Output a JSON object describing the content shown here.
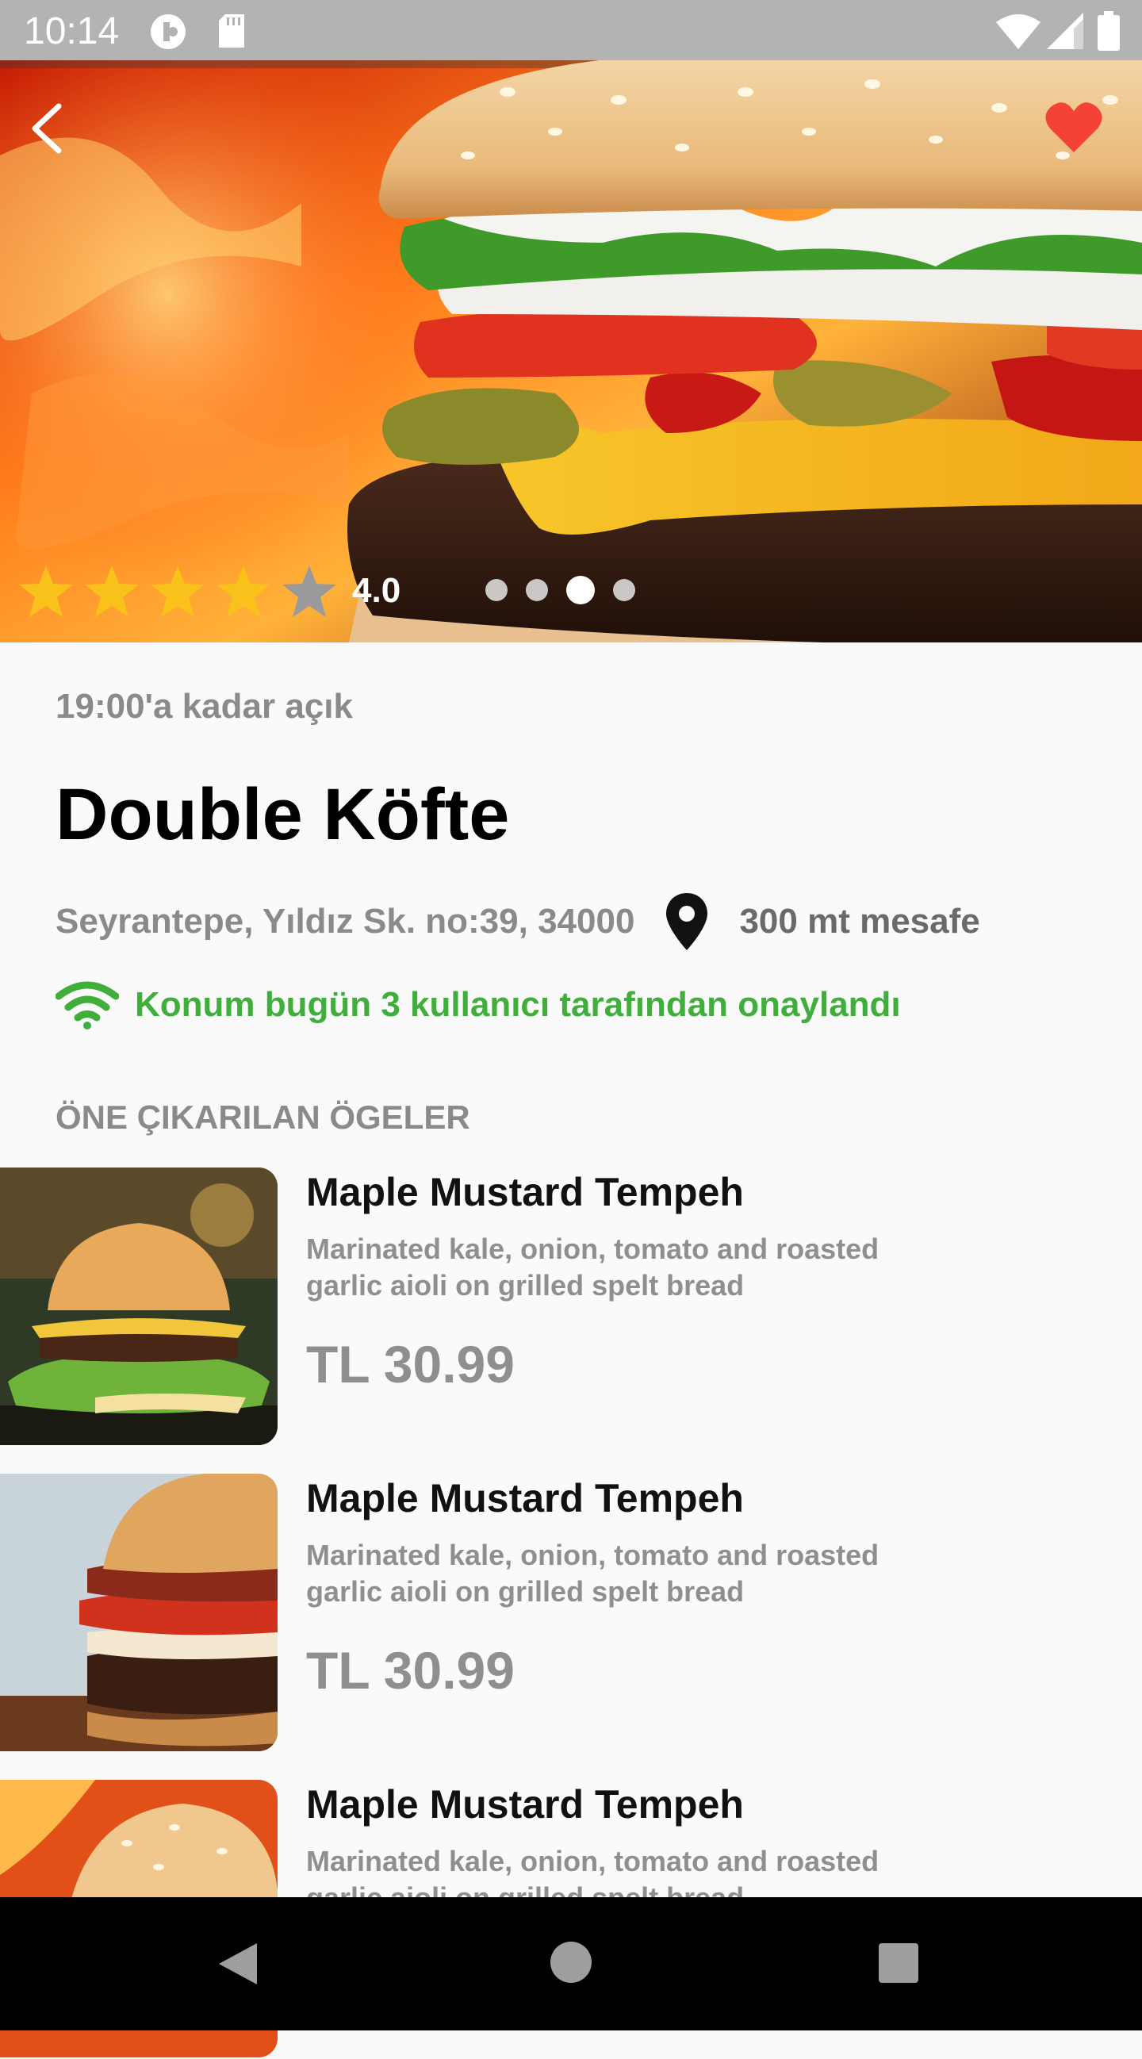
{
  "status_bar": {
    "time": "10:14",
    "icons": [
      "data-saver-icon",
      "sd-card-icon",
      "wifi-icon",
      "cellular-signal-icon",
      "battery-icon"
    ]
  },
  "hero": {
    "rating": "4.0",
    "rating_stars": 4,
    "rating_max": 5,
    "slides_count": 4,
    "active_slide": 3,
    "favorite_color": "#f44336"
  },
  "place": {
    "open_hours": "19:00'a kadar açık",
    "name": "Double Köfte",
    "address": "Seyrantepe, Yıldız Sk. no:39, 34000",
    "distance": "300 mt mesafe",
    "verification": "Konum bugün 3 kullanıcı tarafından onaylandı"
  },
  "featured": {
    "section_title": "ÖNE ÇIKARILAN ÖGELER",
    "items": [
      {
        "name": "Maple Mustard Tempeh",
        "description": "Marinated kale, onion, tomato and roasted garlic aioli on grilled spelt bread",
        "price": "TL 30.99"
      },
      {
        "name": "Maple Mustard Tempeh",
        "description": "Marinated kale, onion, tomato and roasted garlic aioli on grilled spelt bread",
        "price": "TL 30.99"
      },
      {
        "name": "Maple Mustard Tempeh",
        "description": "Marinated kale, onion, tomato and roasted garlic aioli on grilled spelt bread",
        "price": ""
      }
    ]
  },
  "colors": {
    "accent_green": "#3fae3a",
    "star_gold": "#f8c21a",
    "muted_text": "#8a8a8a"
  }
}
